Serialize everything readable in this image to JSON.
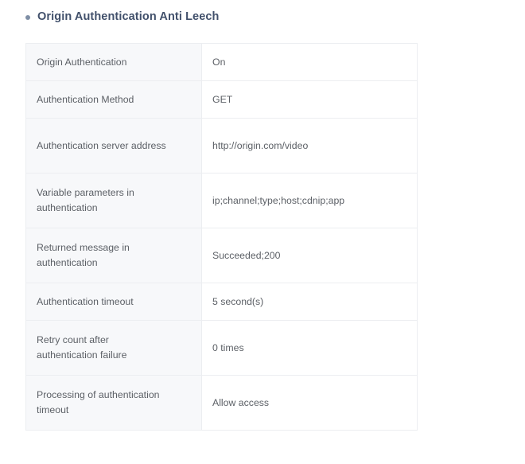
{
  "section": {
    "bullet_icon": "bullet-dot-icon",
    "title": "Origin Authentication Anti Leech"
  },
  "table": {
    "rows": [
      {
        "label": "Origin Authentication",
        "value": "On",
        "lines": 1
      },
      {
        "label": "Authentication Method",
        "value": "GET",
        "lines": 1
      },
      {
        "label": "Authentication server address",
        "value": "http://origin.com/video",
        "lines": 2
      },
      {
        "label": "Variable parameters in authentication",
        "value": "ip;channel;type;host;cdnip;app",
        "lines": 2
      },
      {
        "label": "Returned message in authentication",
        "value": "Succeeded;200",
        "lines": 2
      },
      {
        "label": "Authentication timeout",
        "value": "5 second(s)",
        "lines": 1
      },
      {
        "label": "Retry count after authentication failure",
        "value": "0 times",
        "lines": 2
      },
      {
        "label": "Processing of authentication timeout",
        "value": "Allow access",
        "lines": 2
      }
    ]
  },
  "colors": {
    "title": "#41506b",
    "bullet": "#7f8fa6",
    "label_bg": "#f7f8fa",
    "value_bg": "#ffffff",
    "border": "#eceef1",
    "text": "#5c6066",
    "page_bg": "#ffffff"
  }
}
